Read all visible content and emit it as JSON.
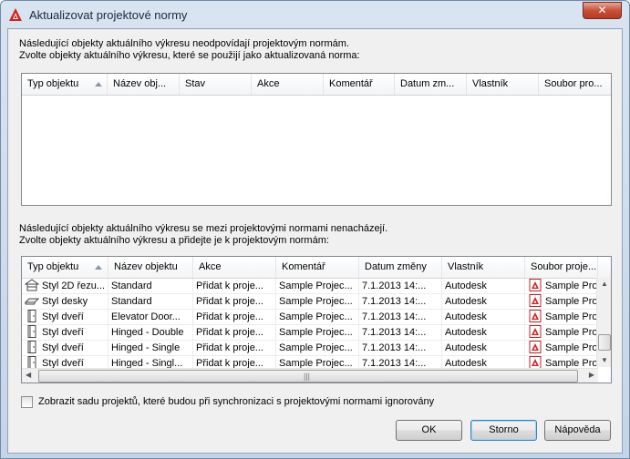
{
  "window": {
    "title": "Aktualizovat projektové normy",
    "close_label": "✕",
    "accent": "#c7503a"
  },
  "top_section": {
    "instruction_line1": "Následující objekty aktuálního výkresu neodpovídají projektovým normám.",
    "instruction_line2": "Zvolte objekty aktuálního výkresu, které se použijí jako aktualizovaná norma:",
    "columns": [
      "Typ objektu",
      "Název obj...",
      "Stav",
      "Akce",
      "Komentář",
      "Datum zm...",
      "Vlastník",
      "Soubor pro..."
    ],
    "rows": []
  },
  "bottom_section": {
    "instruction_line1": "Následující objekty aktuálního výkresu se mezi projektovými normami nenacházejí.",
    "instruction_line2": "Zvolte objekty aktuálního výkresu a přidejte je k projektovým normám:",
    "columns": [
      "Typ objektu",
      "Název objektu",
      "Akce",
      "Komentář",
      "Datum změny",
      "Vlastník",
      "Soubor proje..."
    ],
    "rows": [
      {
        "icon": "section-style-icon",
        "type": "Styl 2D řezu...",
        "name": "Standard",
        "action": "Přidat k proje...",
        "comment": "Sample Projec...",
        "date": "7.1.2013 14:...",
        "owner": "Autodesk",
        "file": "Sample Proj"
      },
      {
        "icon": "slab-style-icon",
        "type": "Styl desky",
        "name": "Standard",
        "action": "Přidat k proje...",
        "comment": "Sample Projec...",
        "date": "7.1.2013 14:...",
        "owner": "Autodesk",
        "file": "Sample Proj"
      },
      {
        "icon": "door-style-icon",
        "type": "Styl dveří",
        "name": "Elevator Door...",
        "action": "Přidat k proje...",
        "comment": "Sample Projec...",
        "date": "7.1.2013 14:...",
        "owner": "Autodesk",
        "file": "Sample Proj"
      },
      {
        "icon": "door-style-icon",
        "type": "Styl dveří",
        "name": "Hinged - Double",
        "action": "Přidat k proje...",
        "comment": "Sample Projec...",
        "date": "7.1.2013 14:...",
        "owner": "Autodesk",
        "file": "Sample Proj"
      },
      {
        "icon": "door-style-icon",
        "type": "Styl dveří",
        "name": "Hinged - Single",
        "action": "Přidat k proje...",
        "comment": "Sample Projec...",
        "date": "7.1.2013 14:...",
        "owner": "Autodesk",
        "file": "Sample Proj"
      },
      {
        "icon": "door-style-icon",
        "type": "Styl dveří",
        "name": "Hinged - Singl...",
        "action": "Přidat k proje...",
        "comment": "Sample Projec...",
        "date": "7.1.2013 14:...",
        "owner": "Autodesk",
        "file": "Sample Proj"
      }
    ]
  },
  "options": {
    "ignore_checkbox_label": "Zobrazit sadu projektů, které budou při synchronizaci s projektovými normami ignorovány",
    "ignore_checked": false
  },
  "buttons": {
    "ok": "OK",
    "cancel": "Storno",
    "help": "Nápověda"
  }
}
